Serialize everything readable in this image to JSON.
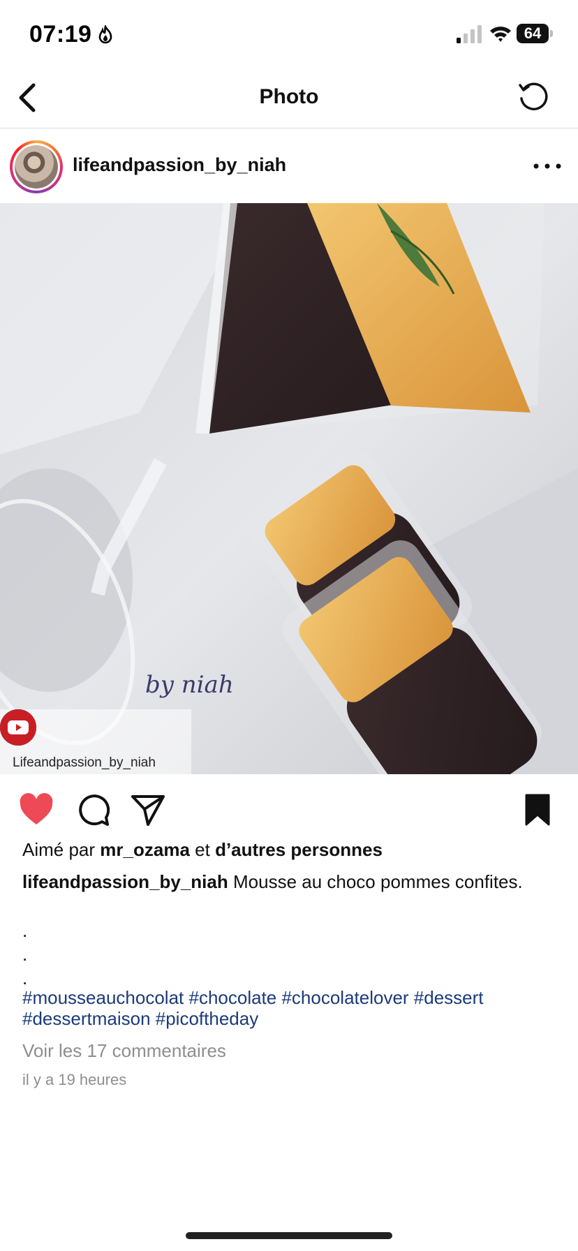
{
  "status_bar": {
    "time": "07:19",
    "battery_level": "64",
    "icons": [
      "flame-icon",
      "signal-icon",
      "wifi-icon",
      "battery-icon"
    ]
  },
  "nav": {
    "title": "Photo",
    "back_icon": "chevron-left-icon",
    "refresh_icon": "refresh-icon"
  },
  "post": {
    "username": "lifeandpassion_by_niah",
    "watermark_text": "by niah",
    "social_handle": "Lifeandpassion_by_niah",
    "social_icons": [
      "tiktok-icon",
      "instagram-icon",
      "facebook-icon",
      "youtube-icon"
    ]
  },
  "actions": {
    "like_color": "#ed4956",
    "liked": true,
    "saved": true
  },
  "likes": {
    "prefix": "Aimé par",
    "user": "mr_ozama",
    "connector": "et",
    "others": "d’autres personnes"
  },
  "caption": {
    "username": "lifeandpassion_by_niah",
    "text": "Mousse au choco pommes confites.",
    "dots": [
      ".",
      ".",
      "."
    ],
    "hashtags": "#mousseauchocolat #chocolate #chocolatelover #dessert #dessertmaison #picoftheday"
  },
  "comments": {
    "view_label": "Voir les 17 commentaires"
  },
  "timestamp": "il y a 19 heures"
}
